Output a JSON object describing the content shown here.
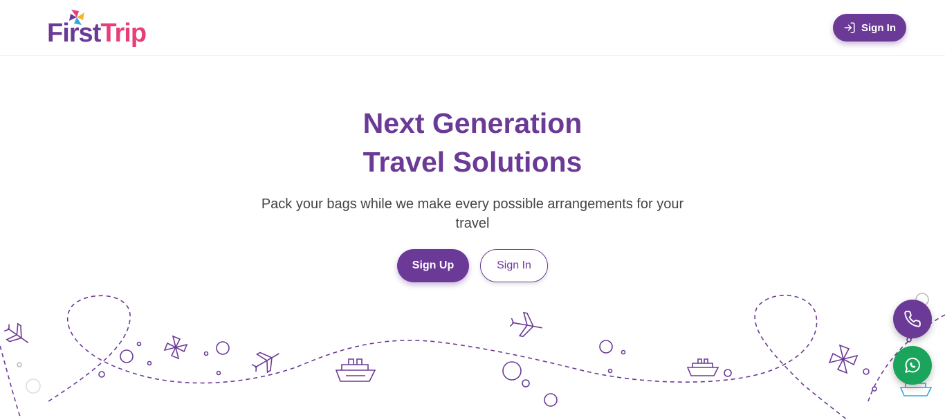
{
  "brand": {
    "first": "First",
    "trip": "Trip"
  },
  "header": {
    "signin_label": "Sign In"
  },
  "hero": {
    "title_line1": "Next Generation",
    "title_line2": "Travel Solutions",
    "subtitle": "Pack your bags while we make every possible arrangements for your travel",
    "signup_label": "Sign Up",
    "signin_label": "Sign In"
  },
  "colors": {
    "brand_purple": "#6b3a96",
    "brand_pink": "#e83e78",
    "whatsapp_green": "#1ba45b"
  },
  "icons": [
    "signin-icon",
    "phone-icon",
    "whatsapp-icon",
    "airplane-icon",
    "ship-icon",
    "pinwheel-icon"
  ]
}
